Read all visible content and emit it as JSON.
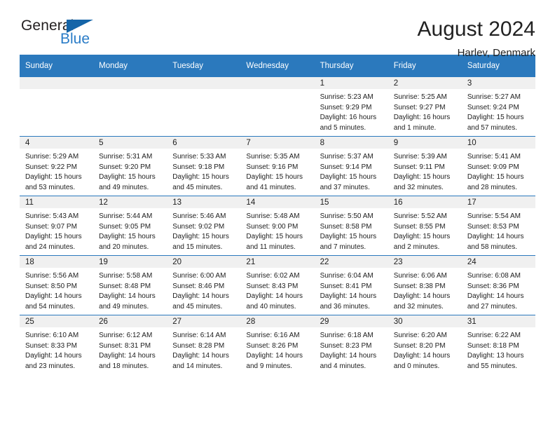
{
  "brand": {
    "word1": "General",
    "word2": "Blue",
    "triangle_color": "#1565a8",
    "blue_text_color": "#2a7cc7",
    "dark_text_color": "#231f20"
  },
  "header": {
    "title": "August 2024",
    "subtitle": "Harlev, Denmark"
  },
  "theme": {
    "header_row_bg": "#2b79bd",
    "daynum_band_bg": "#f0f0f0",
    "cell_bg": "#ffffff",
    "rule_color": "#2b79bd",
    "text_color": "#202020"
  },
  "weekday_headers": [
    "Sunday",
    "Monday",
    "Tuesday",
    "Wednesday",
    "Thursday",
    "Friday",
    "Saturday"
  ],
  "labels": {
    "sunrise_prefix": "Sunrise:",
    "sunset_prefix": "Sunset:",
    "daylight_prefix": "Daylight:"
  },
  "weeks": [
    [
      {
        "day": "",
        "empty": true
      },
      {
        "day": "",
        "empty": true
      },
      {
        "day": "",
        "empty": true
      },
      {
        "day": "",
        "empty": true
      },
      {
        "day": "1",
        "sunrise": "Sunrise: 5:23 AM",
        "sunset": "Sunset: 9:29 PM",
        "daylight_l1": "Daylight: 16 hours",
        "daylight_l2": "and 5 minutes."
      },
      {
        "day": "2",
        "sunrise": "Sunrise: 5:25 AM",
        "sunset": "Sunset: 9:27 PM",
        "daylight_l1": "Daylight: 16 hours",
        "daylight_l2": "and 1 minute."
      },
      {
        "day": "3",
        "sunrise": "Sunrise: 5:27 AM",
        "sunset": "Sunset: 9:24 PM",
        "daylight_l1": "Daylight: 15 hours",
        "daylight_l2": "and 57 minutes."
      }
    ],
    [
      {
        "day": "4",
        "sunrise": "Sunrise: 5:29 AM",
        "sunset": "Sunset: 9:22 PM",
        "daylight_l1": "Daylight: 15 hours",
        "daylight_l2": "and 53 minutes."
      },
      {
        "day": "5",
        "sunrise": "Sunrise: 5:31 AM",
        "sunset": "Sunset: 9:20 PM",
        "daylight_l1": "Daylight: 15 hours",
        "daylight_l2": "and 49 minutes."
      },
      {
        "day": "6",
        "sunrise": "Sunrise: 5:33 AM",
        "sunset": "Sunset: 9:18 PM",
        "daylight_l1": "Daylight: 15 hours",
        "daylight_l2": "and 45 minutes."
      },
      {
        "day": "7",
        "sunrise": "Sunrise: 5:35 AM",
        "sunset": "Sunset: 9:16 PM",
        "daylight_l1": "Daylight: 15 hours",
        "daylight_l2": "and 41 minutes."
      },
      {
        "day": "8",
        "sunrise": "Sunrise: 5:37 AM",
        "sunset": "Sunset: 9:14 PM",
        "daylight_l1": "Daylight: 15 hours",
        "daylight_l2": "and 37 minutes."
      },
      {
        "day": "9",
        "sunrise": "Sunrise: 5:39 AM",
        "sunset": "Sunset: 9:11 PM",
        "daylight_l1": "Daylight: 15 hours",
        "daylight_l2": "and 32 minutes."
      },
      {
        "day": "10",
        "sunrise": "Sunrise: 5:41 AM",
        "sunset": "Sunset: 9:09 PM",
        "daylight_l1": "Daylight: 15 hours",
        "daylight_l2": "and 28 minutes."
      }
    ],
    [
      {
        "day": "11",
        "sunrise": "Sunrise: 5:43 AM",
        "sunset": "Sunset: 9:07 PM",
        "daylight_l1": "Daylight: 15 hours",
        "daylight_l2": "and 24 minutes."
      },
      {
        "day": "12",
        "sunrise": "Sunrise: 5:44 AM",
        "sunset": "Sunset: 9:05 PM",
        "daylight_l1": "Daylight: 15 hours",
        "daylight_l2": "and 20 minutes."
      },
      {
        "day": "13",
        "sunrise": "Sunrise: 5:46 AM",
        "sunset": "Sunset: 9:02 PM",
        "daylight_l1": "Daylight: 15 hours",
        "daylight_l2": "and 15 minutes."
      },
      {
        "day": "14",
        "sunrise": "Sunrise: 5:48 AM",
        "sunset": "Sunset: 9:00 PM",
        "daylight_l1": "Daylight: 15 hours",
        "daylight_l2": "and 11 minutes."
      },
      {
        "day": "15",
        "sunrise": "Sunrise: 5:50 AM",
        "sunset": "Sunset: 8:58 PM",
        "daylight_l1": "Daylight: 15 hours",
        "daylight_l2": "and 7 minutes."
      },
      {
        "day": "16",
        "sunrise": "Sunrise: 5:52 AM",
        "sunset": "Sunset: 8:55 PM",
        "daylight_l1": "Daylight: 15 hours",
        "daylight_l2": "and 2 minutes."
      },
      {
        "day": "17",
        "sunrise": "Sunrise: 5:54 AM",
        "sunset": "Sunset: 8:53 PM",
        "daylight_l1": "Daylight: 14 hours",
        "daylight_l2": "and 58 minutes."
      }
    ],
    [
      {
        "day": "18",
        "sunrise": "Sunrise: 5:56 AM",
        "sunset": "Sunset: 8:50 PM",
        "daylight_l1": "Daylight: 14 hours",
        "daylight_l2": "and 54 minutes."
      },
      {
        "day": "19",
        "sunrise": "Sunrise: 5:58 AM",
        "sunset": "Sunset: 8:48 PM",
        "daylight_l1": "Daylight: 14 hours",
        "daylight_l2": "and 49 minutes."
      },
      {
        "day": "20",
        "sunrise": "Sunrise: 6:00 AM",
        "sunset": "Sunset: 8:46 PM",
        "daylight_l1": "Daylight: 14 hours",
        "daylight_l2": "and 45 minutes."
      },
      {
        "day": "21",
        "sunrise": "Sunrise: 6:02 AM",
        "sunset": "Sunset: 8:43 PM",
        "daylight_l1": "Daylight: 14 hours",
        "daylight_l2": "and 40 minutes."
      },
      {
        "day": "22",
        "sunrise": "Sunrise: 6:04 AM",
        "sunset": "Sunset: 8:41 PM",
        "daylight_l1": "Daylight: 14 hours",
        "daylight_l2": "and 36 minutes."
      },
      {
        "day": "23",
        "sunrise": "Sunrise: 6:06 AM",
        "sunset": "Sunset: 8:38 PM",
        "daylight_l1": "Daylight: 14 hours",
        "daylight_l2": "and 32 minutes."
      },
      {
        "day": "24",
        "sunrise": "Sunrise: 6:08 AM",
        "sunset": "Sunset: 8:36 PM",
        "daylight_l1": "Daylight: 14 hours",
        "daylight_l2": "and 27 minutes."
      }
    ],
    [
      {
        "day": "25",
        "sunrise": "Sunrise: 6:10 AM",
        "sunset": "Sunset: 8:33 PM",
        "daylight_l1": "Daylight: 14 hours",
        "daylight_l2": "and 23 minutes."
      },
      {
        "day": "26",
        "sunrise": "Sunrise: 6:12 AM",
        "sunset": "Sunset: 8:31 PM",
        "daylight_l1": "Daylight: 14 hours",
        "daylight_l2": "and 18 minutes."
      },
      {
        "day": "27",
        "sunrise": "Sunrise: 6:14 AM",
        "sunset": "Sunset: 8:28 PM",
        "daylight_l1": "Daylight: 14 hours",
        "daylight_l2": "and 14 minutes."
      },
      {
        "day": "28",
        "sunrise": "Sunrise: 6:16 AM",
        "sunset": "Sunset: 8:26 PM",
        "daylight_l1": "Daylight: 14 hours",
        "daylight_l2": "and 9 minutes."
      },
      {
        "day": "29",
        "sunrise": "Sunrise: 6:18 AM",
        "sunset": "Sunset: 8:23 PM",
        "daylight_l1": "Daylight: 14 hours",
        "daylight_l2": "and 4 minutes."
      },
      {
        "day": "30",
        "sunrise": "Sunrise: 6:20 AM",
        "sunset": "Sunset: 8:20 PM",
        "daylight_l1": "Daylight: 14 hours",
        "daylight_l2": "and 0 minutes."
      },
      {
        "day": "31",
        "sunrise": "Sunrise: 6:22 AM",
        "sunset": "Sunset: 8:18 PM",
        "daylight_l1": "Daylight: 13 hours",
        "daylight_l2": "and 55 minutes."
      }
    ]
  ]
}
